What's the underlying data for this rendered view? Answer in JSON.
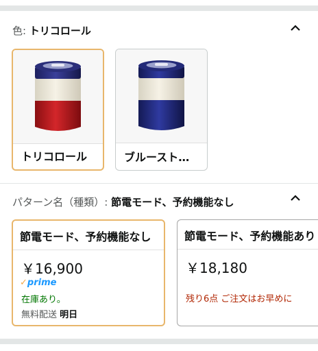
{
  "color_section": {
    "label": "色:",
    "selected_value": "トリコロール",
    "options": [
      {
        "name": "トリコロール",
        "selected": true
      },
      {
        "name": "ブルースト…",
        "selected": false
      }
    ]
  },
  "pattern_section": {
    "label": "パターン名（種類）:",
    "selected_value": "節電モード、予約機能なし",
    "options": [
      {
        "title": "節電モード、予約機能なし",
        "price": "￥16,900",
        "prime": "prime",
        "stock": "在庫あり。",
        "shipping_label": "無料配送",
        "shipping_day": "明日",
        "selected": true
      },
      {
        "title": "節電モード、予約機能あり",
        "price": "￥18,180",
        "stock_note": "残り6点 ご注文はお早めに",
        "selected": false
      }
    ]
  },
  "icons": {
    "collapse": "chevron-up-icon",
    "prime_check": "checkmark-icon"
  },
  "colors": {
    "selected_border": "#e8b66b",
    "in_stock": "#007600",
    "low_stock": "#b12704",
    "prime": "#1a98ff"
  }
}
